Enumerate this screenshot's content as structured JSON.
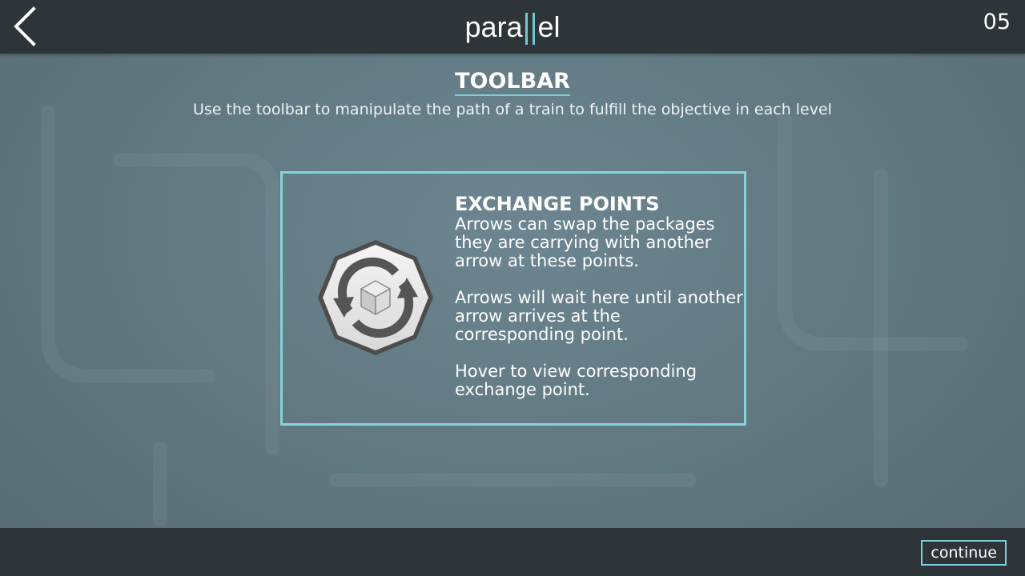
{
  "header": {
    "back_icon": "chevron-left-icon",
    "logo_left": "para",
    "logo_right": "el",
    "level_number": "05"
  },
  "page": {
    "title": "TOOLBAR",
    "subtitle": "Use the toolbar to manipulate the path of a train to fulfill the objective in each level"
  },
  "card": {
    "icon": "exchange-point-icon",
    "heading": "EXCHANGE POINTS",
    "paragraphs": [
      "Arrows can swap the packages they are carrying with another arrow at these points.",
      "Arrows will wait here until another arrow arrives at the corresponding point.",
      "Hover to view corresponding exchange point."
    ]
  },
  "footer": {
    "continue_label": "continue"
  },
  "colors": {
    "accent": "#7fd0d8",
    "bar": "#2e3539",
    "background": "#63797f"
  }
}
